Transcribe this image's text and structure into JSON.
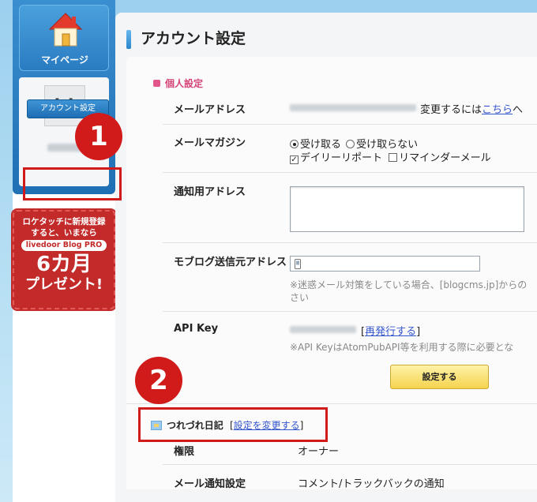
{
  "sidebar": {
    "mypage_label": "マイページ",
    "account_button": "アカウント設定",
    "banner": {
      "line1": "ロケタッチに新規登録",
      "line2": "すると、いまなら",
      "pill": "livedoor Blog PRO",
      "big": "6カ月",
      "present": "プレゼント!"
    }
  },
  "main": {
    "title": "アカウント設定",
    "section_title": "個人設定",
    "email": {
      "label": "メールアドレス",
      "change_prefix": "変更するには",
      "change_link": "こちら",
      "change_suffix": "へ"
    },
    "magazine": {
      "label": "メールマガジン",
      "receive": "受け取る",
      "not_receive": "受け取らない",
      "daily_report": "デイリーリポート",
      "reminder": "リマインダーメール",
      "selected": "受け取る",
      "daily_report_checked": true,
      "reminder_checked": false
    },
    "notify_address": {
      "label": "通知用アドレス",
      "value": ""
    },
    "moblog": {
      "label": "モブログ送信元アドレス",
      "value": "",
      "note_line1": "※迷惑メール対策をしている場合、[blogcms.jp]からの",
      "note_line2": "さい"
    },
    "api_key": {
      "label": "API Key",
      "bracket_open": "[",
      "reissue_link": "再発行する",
      "bracket_close": "]",
      "note": "※API KeyはAtomPubAPI等を利用する際に必要とな"
    },
    "submit_label": "設定する",
    "blog": {
      "name": "つれづれ日記",
      "bracket_open": "[",
      "change_link": "設定を変更する",
      "bracket_close": "]",
      "permission_label": "権限",
      "permission_value": "オーナー",
      "mail_notify_label": "メール通知設定",
      "mail_notify_value": "コメント/トラックバックの通知"
    }
  },
  "annotations": {
    "badge1": "1",
    "badge2": "2",
    "color": "#d11a1a"
  }
}
